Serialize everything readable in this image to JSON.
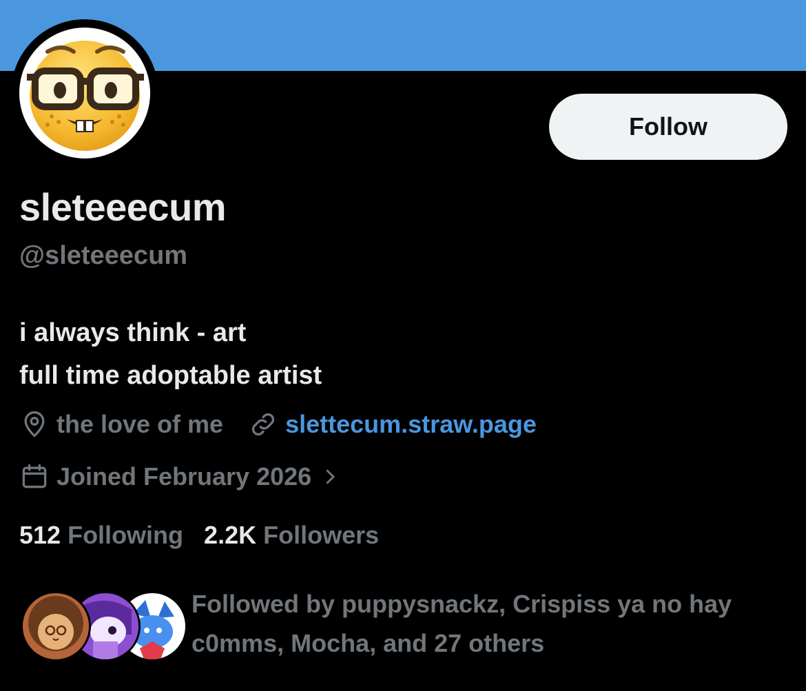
{
  "profile": {
    "display_name": "sleteeecum",
    "handle": "@sleteeecum",
    "bio_line1": "i always think - art",
    "bio_line2": "full time adoptable artist",
    "location": "the love of me",
    "website": "slettecum.straw.page",
    "joined": "Joined February 2026",
    "avatar_icon": "nerd-face-icon"
  },
  "actions": {
    "follow_label": "Follow"
  },
  "stats": {
    "following_count": "512",
    "following_label": "Following",
    "followers_count": "2.2K",
    "followers_label": "Followers"
  },
  "followed_by": {
    "text": "Followed by puppysnackz, Crispiss ya no hay c0mms, Mocha, and 27 others"
  },
  "colors": {
    "banner": "#4a97e0",
    "background": "#000000",
    "primary_text": "#e7e9ea",
    "secondary_text": "#71767b",
    "link": "#4a97e0",
    "follow_button_bg": "#eff3f4"
  }
}
